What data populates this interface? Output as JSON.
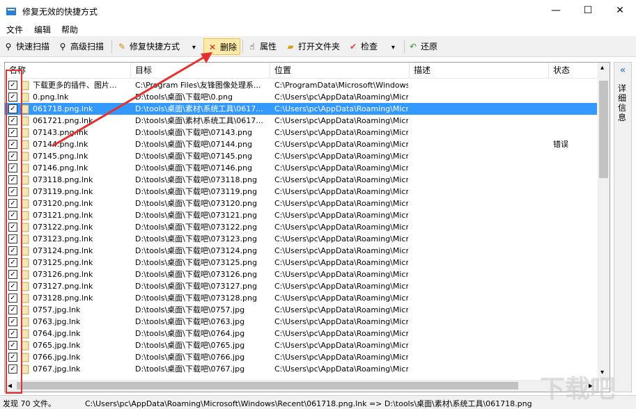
{
  "window": {
    "title": "修复无效的快捷方式",
    "minimize": "—",
    "maximize": "☐",
    "close": "✕"
  },
  "menu": [
    "文件",
    "编辑",
    "帮助"
  ],
  "toolbar": {
    "quick_scan": "快速扫描",
    "advanced_scan": "高级扫描",
    "repair": "修复快捷方式",
    "delete": "删除",
    "properties": "属性",
    "open_folder": "打开文件夹",
    "check": "检查",
    "restore": "还原",
    "dropdown": "▾"
  },
  "columns": {
    "name": "名称",
    "target": "目标",
    "location": "位置",
    "description": "描述",
    "status": "状态"
  },
  "rows": [
    {
      "name": "下载更多的插件、图片...",
      "target": "C:\\Program Files\\友锋图像处理系...",
      "location": "C:\\ProgramData\\Microsoft\\Windows...",
      "status": "",
      "selected": false,
      "check": "✓"
    },
    {
      "name": "0.png.lnk",
      "target": "D:\\tools\\桌面\\下载吧\\0.png",
      "location": "C:\\Users\\pc\\AppData\\Roaming\\Micr...",
      "status": "",
      "selected": false,
      "check": "✓"
    },
    {
      "name": "061718.png.lnk",
      "target": "D:\\tools\\桌面\\素材\\系统工具\\0617...",
      "location": "C:\\Users\\pc\\AppData\\Roaming\\Micr...",
      "status": "",
      "selected": true,
      "check": "✓"
    },
    {
      "name": "061721.png.lnk",
      "target": "D:\\tools\\桌面\\素材\\系统工具\\0617...",
      "location": "C:\\Users\\pc\\AppData\\Roaming\\Micr...",
      "status": "",
      "selected": false,
      "check": "✓"
    },
    {
      "name": "07143.png.lnk",
      "target": "D:\\tools\\桌面\\下载吧\\07143.png",
      "location": "C:\\Users\\pc\\AppData\\Roaming\\Micr...",
      "status": "",
      "selected": false,
      "check": "✓"
    },
    {
      "name": "07144.png.lnk",
      "target": "D:\\tools\\桌面\\下载吧\\07144.png",
      "location": "C:\\Users\\pc\\AppData\\Roaming\\Micr...",
      "status": "错误",
      "selected": false,
      "check": "✓"
    },
    {
      "name": "07145.png.lnk",
      "target": "D:\\tools\\桌面\\下载吧\\07145.png",
      "location": "C:\\Users\\pc\\AppData\\Roaming\\Micr...",
      "status": "",
      "selected": false,
      "check": "✓"
    },
    {
      "name": "07146.png.lnk",
      "target": "D:\\tools\\桌面\\下载吧\\07146.png",
      "location": "C:\\Users\\pc\\AppData\\Roaming\\Micr...",
      "status": "",
      "selected": false,
      "check": "✓"
    },
    {
      "name": "073118.png.lnk",
      "target": "D:\\tools\\桌面\\下载吧\\073118.png",
      "location": "C:\\Users\\pc\\AppData\\Roaming\\Micr...",
      "status": "",
      "selected": false,
      "check": "✓"
    },
    {
      "name": "073119.png.lnk",
      "target": "D:\\tools\\桌面\\下载吧\\073119.png",
      "location": "C:\\Users\\pc\\AppData\\Roaming\\Micr...",
      "status": "",
      "selected": false,
      "check": "✓"
    },
    {
      "name": "073120.png.lnk",
      "target": "D:\\tools\\桌面\\下载吧\\073120.png",
      "location": "C:\\Users\\pc\\AppData\\Roaming\\Micr...",
      "status": "",
      "selected": false,
      "check": "✓"
    },
    {
      "name": "073121.png.lnk",
      "target": "D:\\tools\\桌面\\下载吧\\073121.png",
      "location": "C:\\Users\\pc\\AppData\\Roaming\\Micr...",
      "status": "",
      "selected": false,
      "check": "✓"
    },
    {
      "name": "073122.png.lnk",
      "target": "D:\\tools\\桌面\\下载吧\\073122.png",
      "location": "C:\\Users\\pc\\AppData\\Roaming\\Micr...",
      "status": "",
      "selected": false,
      "check": "✓"
    },
    {
      "name": "073123.png.lnk",
      "target": "D:\\tools\\桌面\\下载吧\\073123.png",
      "location": "C:\\Users\\pc\\AppData\\Roaming\\Micr...",
      "status": "",
      "selected": false,
      "check": "✓"
    },
    {
      "name": "073124.png.lnk",
      "target": "D:\\tools\\桌面\\下载吧\\073124.png",
      "location": "C:\\Users\\pc\\AppData\\Roaming\\Micr...",
      "status": "",
      "selected": false,
      "check": "✓"
    },
    {
      "name": "073125.png.lnk",
      "target": "D:\\tools\\桌面\\下载吧\\073125.png",
      "location": "C:\\Users\\pc\\AppData\\Roaming\\Micr...",
      "status": "",
      "selected": false,
      "check": "✓"
    },
    {
      "name": "073126.png.lnk",
      "target": "D:\\tools\\桌面\\下载吧\\073126.png",
      "location": "C:\\Users\\pc\\AppData\\Roaming\\Micr...",
      "status": "",
      "selected": false,
      "check": "✓"
    },
    {
      "name": "073127.png.lnk",
      "target": "D:\\tools\\桌面\\下载吧\\073127.png",
      "location": "C:\\Users\\pc\\AppData\\Roaming\\Micr...",
      "status": "",
      "selected": false,
      "check": "✓"
    },
    {
      "name": "073128.png.lnk",
      "target": "D:\\tools\\桌面\\下载吧\\073128.png",
      "location": "C:\\Users\\pc\\AppData\\Roaming\\Micr...",
      "status": "",
      "selected": false,
      "check": "✓"
    },
    {
      "name": "0757.jpg.lnk",
      "target": "D:\\tools\\桌面\\下载吧\\0757.jpg",
      "location": "C:\\Users\\pc\\AppData\\Roaming\\Micr...",
      "status": "",
      "selected": false,
      "check": "✓"
    },
    {
      "name": "0763.jpg.lnk",
      "target": "D:\\tools\\桌面\\下载吧\\0763.jpg",
      "location": "C:\\Users\\pc\\AppData\\Roaming\\Micr...",
      "status": "",
      "selected": false,
      "check": "✓"
    },
    {
      "name": "0764.jpg.lnk",
      "target": "D:\\tools\\桌面\\下载吧\\0764.jpg",
      "location": "C:\\Users\\pc\\AppData\\Roaming\\Micr...",
      "status": "",
      "selected": false,
      "check": "✓"
    },
    {
      "name": "0765.jpg.lnk",
      "target": "D:\\tools\\桌面\\下载吧\\0765.jpg",
      "location": "C:\\Users\\pc\\AppData\\Roaming\\Micr...",
      "status": "",
      "selected": false,
      "check": "✓"
    },
    {
      "name": "0766.jpg.lnk",
      "target": "D:\\tools\\桌面\\下载吧\\0766.jpg",
      "location": "C:\\Users\\pc\\AppData\\Roaming\\Micr...",
      "status": "",
      "selected": false,
      "check": "✓"
    },
    {
      "name": "0767.jpg.lnk",
      "target": "D:\\tools\\桌面\\下载吧\\0767.jpg",
      "location": "C:\\Users\\pc\\AppData\\Roaming\\Micr...",
      "status": "",
      "selected": false,
      "check": "✓"
    }
  ],
  "side_panel": {
    "collapse": "«",
    "label": "详细信息"
  },
  "status": {
    "count": "发现 70 文件。",
    "path": "C:\\Users\\pc\\AppData\\Roaming\\Microsoft\\Windows\\Recent\\061718.png.lnk => D:\\tools\\桌面\\素材\\系统工具\\061718.png"
  },
  "scroll": {
    "left_arrow": "◂",
    "right_arrow": "▸",
    "down_arrow": "▾"
  },
  "colors": {
    "selection": "#3399ff",
    "highlight": "#fde9a8",
    "annotation": "#e53030"
  }
}
